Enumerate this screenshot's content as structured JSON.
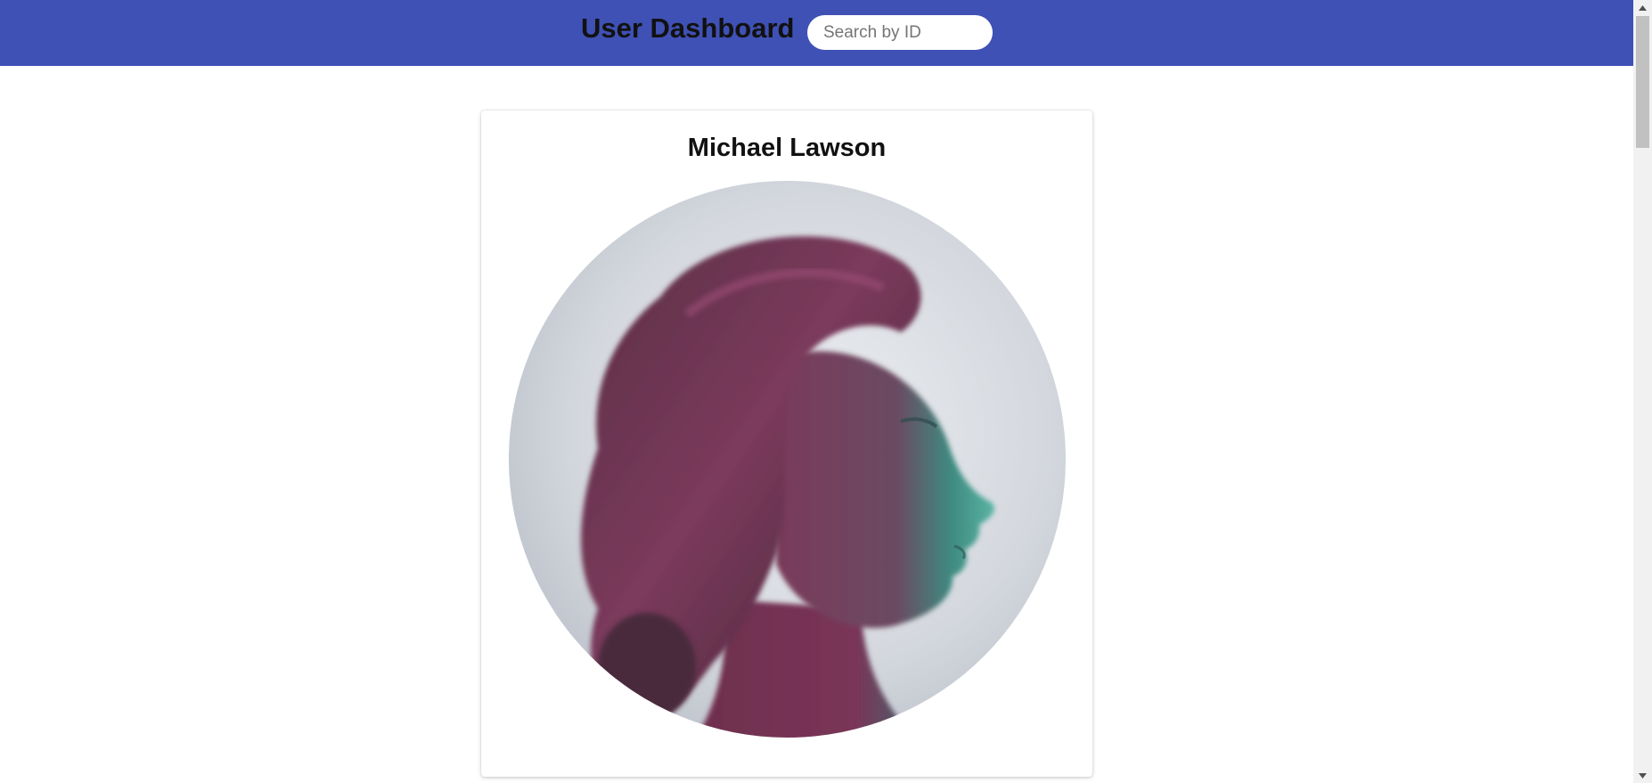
{
  "header": {
    "title": "User Dashboard",
    "search_placeholder": "Search by ID",
    "search_value": "",
    "background_color": "#3f51b5"
  },
  "profile": {
    "name": "Michael Lawson",
    "avatar_icon": "profile-portrait-photo"
  },
  "scrollbar": {
    "up_icon": "chevron-up-icon",
    "down_icon": "chevron-down-icon"
  }
}
